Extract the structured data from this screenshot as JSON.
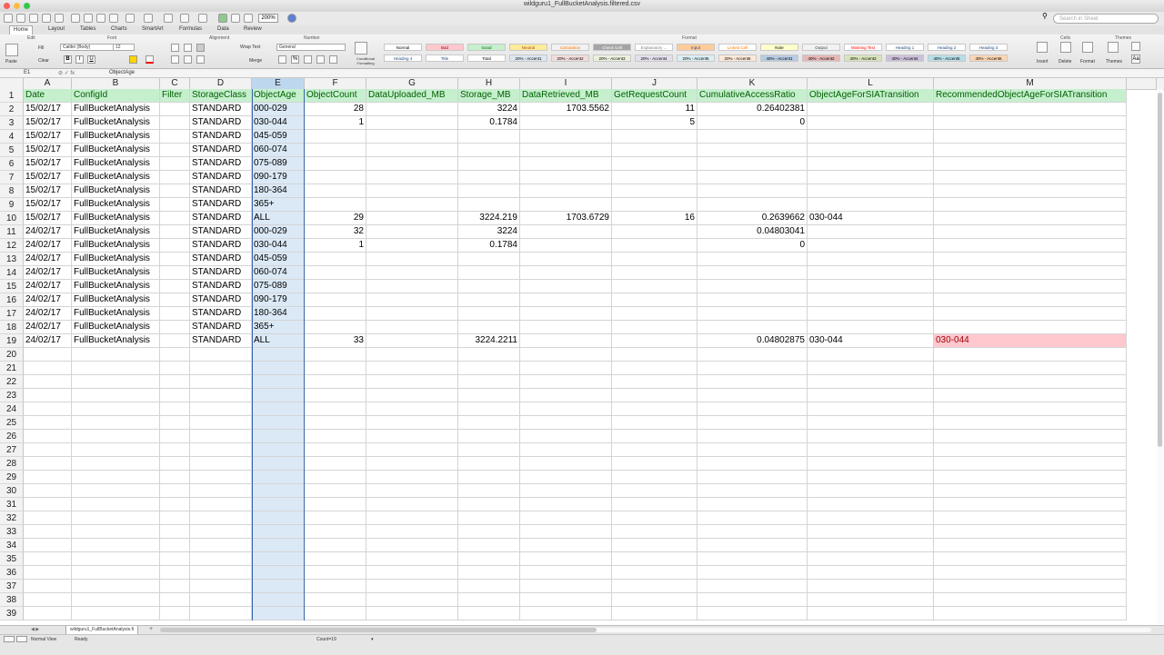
{
  "window": {
    "title": "wildguru1_FullBucketAnalysis.filtered.csv"
  },
  "toolbar": {
    "zoom": "200%",
    "search_placeholder": "Search in Sheet"
  },
  "ribbon": {
    "tabs": [
      "Home",
      "Layout",
      "Tables",
      "Charts",
      "SmartArt",
      "Formulas",
      "Data",
      "Review"
    ],
    "active_tab": "Home",
    "groups": {
      "edit": "Edit",
      "font": "Font",
      "alignment": "Alignment",
      "number": "Number",
      "format": "Format",
      "cells": "Cells",
      "themes": "Themes"
    },
    "edit": {
      "fill": "Fill",
      "clear": "Clear",
      "paste": "Paste"
    },
    "font": {
      "name": "Calibri (Body)",
      "size": "12"
    },
    "alignment": {
      "wrap_text": "Wrap Text",
      "merge": "Merge"
    },
    "number": {
      "format": "General"
    },
    "conditional_formatting": "Conditional Formatting",
    "styles": [
      {
        "label": "Normal",
        "bg": "#ffffff",
        "fg": "#000000"
      },
      {
        "label": "Bad",
        "bg": "#ffc7ce",
        "fg": "#9c0006"
      },
      {
        "label": "Good",
        "bg": "#c6efce",
        "fg": "#006100"
      },
      {
        "label": "Neutral",
        "bg": "#ffeb9c",
        "fg": "#9c5700"
      },
      {
        "label": "Calculation",
        "bg": "#f2f2f2",
        "fg": "#fa7d00"
      },
      {
        "label": "Check Cell",
        "bg": "#a5a5a5",
        "fg": "#ffffff"
      },
      {
        "label": "Explanatory ...",
        "bg": "#ffffff",
        "fg": "#7f7f7f"
      },
      {
        "label": "Input",
        "bg": "#ffcc99",
        "fg": "#3f3f76"
      },
      {
        "label": "Linked Cell",
        "bg": "#ffffff",
        "fg": "#fa7d00"
      },
      {
        "label": "Note",
        "bg": "#ffffcc",
        "fg": "#000000"
      },
      {
        "label": "Output",
        "bg": "#f2f2f2",
        "fg": "#3f3f3f"
      },
      {
        "label": "Warning Text",
        "bg": "#ffffff",
        "fg": "#ff0000"
      },
      {
        "label": "Heading 1",
        "bg": "#ffffff",
        "fg": "#1f497d"
      },
      {
        "label": "Heading 2",
        "bg": "#ffffff",
        "fg": "#1f497d"
      },
      {
        "label": "Heading 3",
        "bg": "#ffffff",
        "fg": "#1f497d"
      },
      {
        "label": "Heading 4",
        "bg": "#ffffff",
        "fg": "#1f497d"
      },
      {
        "label": "Title",
        "bg": "#ffffff",
        "fg": "#1f497d"
      },
      {
        "label": "Total",
        "bg": "#ffffff",
        "fg": "#000000"
      },
      {
        "label": "20% - Accent1",
        "bg": "#dce6f1",
        "fg": "#000000"
      },
      {
        "label": "20% - Accent2",
        "bg": "#f2dcdb",
        "fg": "#000000"
      },
      {
        "label": "20% - Accent3",
        "bg": "#ebf1de",
        "fg": "#000000"
      },
      {
        "label": "20% - Accent4",
        "bg": "#e4dfec",
        "fg": "#000000"
      },
      {
        "label": "20% - Accent5",
        "bg": "#daeef3",
        "fg": "#000000"
      },
      {
        "label": "20% - Accent6",
        "bg": "#fde9d9",
        "fg": "#000000"
      },
      {
        "label": "40% - Accent1",
        "bg": "#b8cce4",
        "fg": "#000000"
      },
      {
        "label": "40% - Accent2",
        "bg": "#e6b8b7",
        "fg": "#000000"
      },
      {
        "label": "40% - Accent3",
        "bg": "#d8e4bc",
        "fg": "#000000"
      },
      {
        "label": "40% - Accent4",
        "bg": "#ccc0da",
        "fg": "#000000"
      },
      {
        "label": "40% - Accent5",
        "bg": "#b7dee8",
        "fg": "#000000"
      },
      {
        "label": "40% - Accent6",
        "bg": "#fcd5b4",
        "fg": "#000000"
      }
    ],
    "cells_buttons": [
      "Insert",
      "Delete",
      "Format"
    ],
    "themes_button": "Themes"
  },
  "formula_bar": {
    "cell_ref": "E1",
    "content": "ObjectAge"
  },
  "sheet": {
    "columns": [
      "A",
      "B",
      "C",
      "D",
      "E",
      "F",
      "G",
      "H",
      "I",
      "J",
      "K",
      "L",
      "M"
    ],
    "selected_column": "E",
    "header_row": [
      "Date",
      "ConfigId",
      "Filter",
      "StorageClass",
      "ObjectAge",
      "ObjectCount",
      "DataUploaded_MB",
      "Storage_MB",
      "DataRetrieved_MB",
      "GetRequestCount",
      "CumulativeAccessRatio",
      "ObjectAgeForSIATransition",
      "RecommendedObjectAgeForSIATransition"
    ],
    "rows": [
      [
        "15/02/17",
        "FullBucketAnalysis",
        "",
        "STANDARD",
        "000-029",
        "28",
        "",
        "3224",
        "1703.5562",
        "11",
        "0.26402381",
        "",
        ""
      ],
      [
        "15/02/17",
        "FullBucketAnalysis",
        "",
        "STANDARD",
        "030-044",
        "1",
        "",
        "0.1784",
        "",
        "5",
        "0",
        "",
        ""
      ],
      [
        "15/02/17",
        "FullBucketAnalysis",
        "",
        "STANDARD",
        "045-059",
        "",
        "",
        "",
        "",
        "",
        "",
        "",
        ""
      ],
      [
        "15/02/17",
        "FullBucketAnalysis",
        "",
        "STANDARD",
        "060-074",
        "",
        "",
        "",
        "",
        "",
        "",
        "",
        ""
      ],
      [
        "15/02/17",
        "FullBucketAnalysis",
        "",
        "STANDARD",
        "075-089",
        "",
        "",
        "",
        "",
        "",
        "",
        "",
        ""
      ],
      [
        "15/02/17",
        "FullBucketAnalysis",
        "",
        "STANDARD",
        "090-179",
        "",
        "",
        "",
        "",
        "",
        "",
        "",
        ""
      ],
      [
        "15/02/17",
        "FullBucketAnalysis",
        "",
        "STANDARD",
        "180-364",
        "",
        "",
        "",
        "",
        "",
        "",
        "",
        ""
      ],
      [
        "15/02/17",
        "FullBucketAnalysis",
        "",
        "STANDARD",
        "365+",
        "",
        "",
        "",
        "",
        "",
        "",
        "",
        ""
      ],
      [
        "15/02/17",
        "FullBucketAnalysis",
        "",
        "STANDARD",
        "ALL",
        "29",
        "",
        "3224.219",
        "1703.6729",
        "16",
        "0.2639662",
        "030-044",
        ""
      ],
      [
        "24/02/17",
        "FullBucketAnalysis",
        "",
        "STANDARD",
        "000-029",
        "32",
        "",
        "3224",
        "",
        "",
        "0.04803041",
        "",
        ""
      ],
      [
        "24/02/17",
        "FullBucketAnalysis",
        "",
        "STANDARD",
        "030-044",
        "1",
        "",
        "0.1784",
        "",
        "",
        "0",
        "",
        ""
      ],
      [
        "24/02/17",
        "FullBucketAnalysis",
        "",
        "STANDARD",
        "045-059",
        "",
        "",
        "",
        "",
        "",
        "",
        "",
        ""
      ],
      [
        "24/02/17",
        "FullBucketAnalysis",
        "",
        "STANDARD",
        "060-074",
        "",
        "",
        "",
        "",
        "",
        "",
        "",
        ""
      ],
      [
        "24/02/17",
        "FullBucketAnalysis",
        "",
        "STANDARD",
        "075-089",
        "",
        "",
        "",
        "",
        "",
        "",
        "",
        ""
      ],
      [
        "24/02/17",
        "FullBucketAnalysis",
        "",
        "STANDARD",
        "090-179",
        "",
        "",
        "",
        "",
        "",
        "",
        "",
        ""
      ],
      [
        "24/02/17",
        "FullBucketAnalysis",
        "",
        "STANDARD",
        "180-364",
        "",
        "",
        "",
        "",
        "",
        "",
        "",
        ""
      ],
      [
        "24/02/17",
        "FullBucketAnalysis",
        "",
        "STANDARD",
        "365+",
        "",
        "",
        "",
        "",
        "",
        "",
        "",
        ""
      ],
      [
        "24/02/17",
        "FullBucketAnalysis",
        "",
        "STANDARD",
        "ALL",
        "33",
        "",
        "3224.2211",
        "",
        "",
        "0.04802875",
        "030-044",
        "030-044"
      ]
    ],
    "numeric_columns": [
      5,
      6,
      7,
      8,
      9,
      10
    ],
    "highlight_bad_cell": {
      "row": 19,
      "col": 12
    },
    "total_rows_visible": 39,
    "header_fill": "#c6efce",
    "header_text_color": "#006100",
    "bad_fill": "#ffc7ce",
    "bad_text_color": "#9c0006"
  },
  "sheet_tab": {
    "name": "wildguru1_FullBucketAnalysis.fi"
  },
  "status": {
    "view": "Normal View",
    "state": "Ready",
    "count": "Count=19"
  }
}
